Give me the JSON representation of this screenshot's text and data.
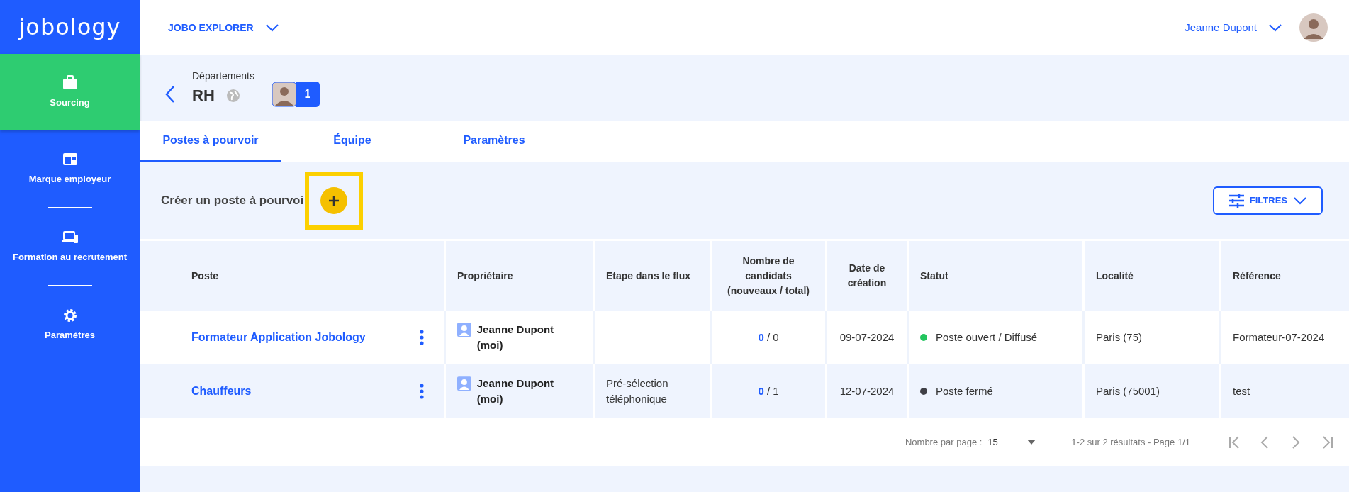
{
  "sidebar": {
    "logo": "jobology",
    "items": [
      {
        "label": "Sourcing",
        "selected": true
      },
      {
        "label": "Marque employeur",
        "selected": false
      },
      {
        "label": "Formation au recrutement",
        "selected": false
      },
      {
        "label": "Paramètres",
        "selected": false
      }
    ]
  },
  "header": {
    "product_menu": "JOBO EXPLORER",
    "user_name": "Jeanne Dupont"
  },
  "department": {
    "caption": "Départements",
    "name": "RH",
    "member_count": "1"
  },
  "tabs": [
    {
      "label": "Postes à pourvoir",
      "selected": true
    },
    {
      "label": "Équipe",
      "selected": false
    },
    {
      "label": "Paramètres",
      "selected": false
    }
  ],
  "toolbar": {
    "create_label": "Créer un poste à pourvoi",
    "filter_button": "FILTRES"
  },
  "table": {
    "columns": [
      "Poste",
      "Propriétaire",
      "Etape dans le flux",
      "Nombre de candidats (nouveaux / total)",
      "Date de création",
      "Statut",
      "Localité",
      "Référence"
    ],
    "rows": [
      {
        "title": "Formateur Application Jobology",
        "owner": "Jeanne Dupont (moi)",
        "new": "0",
        "total": "/ 0",
        "date": "09-07-2024",
        "status": "Poste ouvert / Diffusé",
        "color": "#22c55e",
        "location": "Paris (75)",
        "reference": "Formateur-07-2024"
      },
      {
        "title": "Chauffeurs",
        "owner": "Jeanne Dupont (moi)",
        "stage": "Pré-sélection téléphonique",
        "new": "0",
        "total": "/ 1",
        "date": "12-07-2024",
        "status": "Poste fermé",
        "color": "#3f3f46",
        "location": "Paris (75001)",
        "reference": "test"
      }
    ]
  },
  "pagination": {
    "per_page_label": "Nombre par page :",
    "per_page": "15",
    "summary": "1-2 sur 2 résultats - Page 1/1"
  }
}
